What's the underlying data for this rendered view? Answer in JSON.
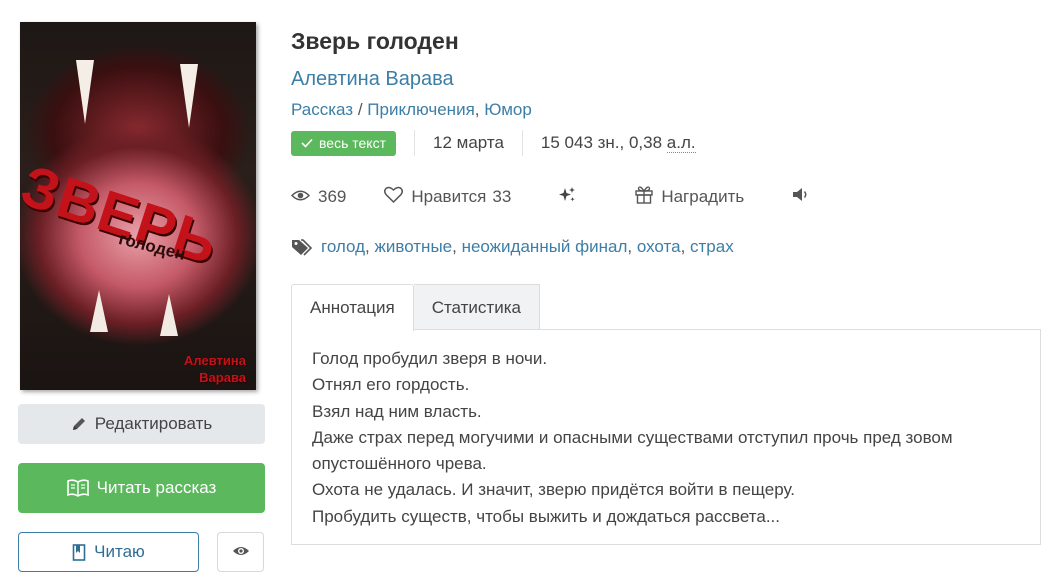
{
  "book": {
    "cover": {
      "title": "ЗВЕРЬ",
      "subtitle": "голоден",
      "author_line1": "Алевтина",
      "author_line2": "Варава"
    },
    "title": "Зверь голоден",
    "author": "Алевтина Варава",
    "category": "Рассказ",
    "genre_sep": " / ",
    "genre1": "Приключения",
    "genre_comma": ", ",
    "genre2": "Юмор",
    "badge": "весь текст",
    "date": "12 марта",
    "size": "15 043 зн., 0,38 ",
    "size_unit": "а.л."
  },
  "stats": {
    "views": "369",
    "likes_label": "Нравится",
    "likes": "33",
    "reward_label": "Наградить"
  },
  "tags": [
    {
      "label": "голод",
      "sep": ", "
    },
    {
      "label": "животные",
      "sep": ", "
    },
    {
      "label": "неожиданный финал",
      "sep": ", "
    },
    {
      "label": "охота",
      "sep": ", "
    },
    {
      "label": "страх",
      "sep": ""
    }
  ],
  "tabs": {
    "annotation": "Аннотация",
    "statistics": "Статистика"
  },
  "annotation": [
    "Голод пробудил зверя в ночи.",
    "Отнял его гордость.",
    "Взял над ним власть.",
    "Даже страх перед могучими и опасными существами отступил прочь пред зовом опустошённого чрева.",
    "Охота не удалась. И значит, зверю придётся войти в пещеру.",
    "Пробудить существ, чтобы выжить и дождаться рассвета..."
  ],
  "buttons": {
    "edit": "Редактировать",
    "read": "Читать рассказ",
    "reading": "Читаю"
  },
  "colors": {
    "link": "#3d7ea6",
    "green": "#5cb85c",
    "cover_red": "#c4121a"
  },
  "icons": [
    "pencil-icon",
    "open-book-icon",
    "bookmark-icon",
    "eye-icon",
    "heart-icon",
    "sparkles-icon",
    "gift-icon",
    "speaker-icon",
    "tags-icon",
    "check-icon"
  ]
}
